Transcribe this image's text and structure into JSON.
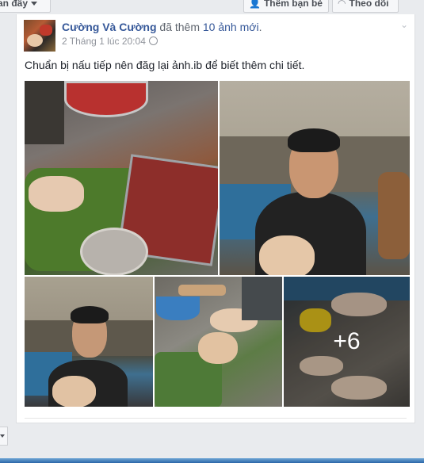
{
  "toolbar": {
    "feed_select": "an đây",
    "add_friend": "Thêm bạn bè",
    "follow": "Theo dõi"
  },
  "post": {
    "author": "Cường Và Cường",
    "action_prefix": "đã thêm",
    "photo_count": "10 ảnh mới",
    "action_suffix": ".",
    "timestamp": "2 Tháng 1 lúc 20:04",
    "text": "Chuẩn bị nấu tiếp nên đăg lại ảnh.ib để biết thêm chi tiết.",
    "more_photos": "+6"
  },
  "icons": {
    "add_friend": "add-friend-icon",
    "follow": "rss-icon",
    "privacy": "globe-icon",
    "menu": "chevron-down-icon"
  }
}
